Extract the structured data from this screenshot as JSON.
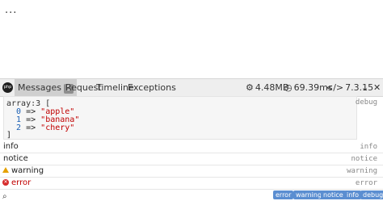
{
  "page": {
    "text": "..."
  },
  "debugbar": {
    "logo_text": "php",
    "tabs": [
      {
        "label": "Messages",
        "badge": "5"
      },
      {
        "label": "Request"
      },
      {
        "label": "Timeline"
      },
      {
        "label": "Exceptions"
      }
    ],
    "indicators": {
      "memory": "4.48MB",
      "time": "69.39ms",
      "php_version": "7.3.15"
    }
  },
  "dump": {
    "line1_key": "array:3",
    "line1_open": " [",
    "items": [
      {
        "index": "0",
        "value": "\"apple\""
      },
      {
        "index": "1",
        "value": "\"banana\""
      },
      {
        "index": "2",
        "value": "\"chery\""
      }
    ],
    "close": "]",
    "label": "debug"
  },
  "messages": [
    {
      "text": "info",
      "tag": "info"
    },
    {
      "text": "notice",
      "tag": "notice"
    },
    {
      "text": "warning",
      "tag": "warning"
    },
    {
      "text": "error",
      "tag": "error"
    }
  ],
  "filters": [
    "error",
    "warning",
    "notice",
    "info",
    "debug"
  ],
  "colors": {
    "filter_bg": "#5b8ed1",
    "error_red": "#c10000",
    "warning_amber": "#e5a000"
  }
}
